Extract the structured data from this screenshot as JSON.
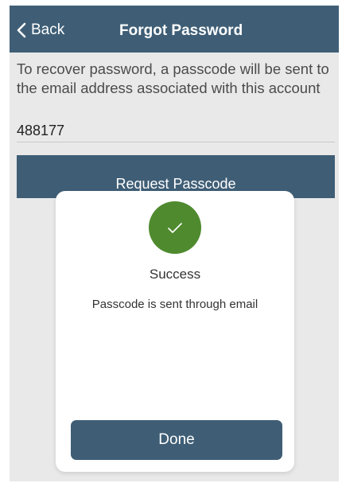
{
  "navbar": {
    "back_label": "Back",
    "title": "Forgot Password",
    "background_color": "#3f5e76"
  },
  "instructions": "To recover password, a passcode will be sent to the email address associated with this account",
  "passcode_field": {
    "value": "488177"
  },
  "request_button": {
    "label": "Request Passcode"
  },
  "dialog": {
    "icon": "checkmark-icon",
    "icon_color": "#4f8a2f",
    "title": "Success",
    "message": "Passcode is sent through email",
    "done_label": "Done"
  }
}
